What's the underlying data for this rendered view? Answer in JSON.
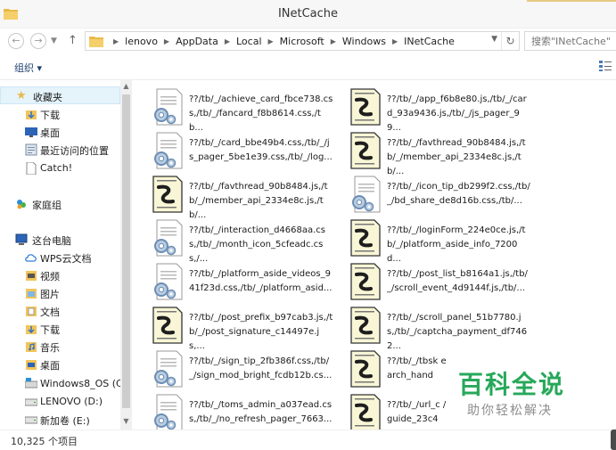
{
  "window": {
    "title": "INetCache"
  },
  "address": {
    "crumbs": [
      "lenovo",
      "AppData",
      "Local",
      "Microsoft",
      "Windows",
      "INetCache"
    ],
    "search_placeholder": "搜索\"INetCache\""
  },
  "toolbar": {
    "organize_label": "组织 ▾"
  },
  "nav": {
    "items": [
      {
        "label": "收藏夹",
        "icon": "star-icon"
      },
      {
        "label": "下载",
        "icon": "download-folder-icon"
      },
      {
        "label": "桌面",
        "icon": "desktop-icon"
      },
      {
        "label": "最近访问的位置",
        "icon": "recent-places-icon"
      },
      {
        "label": "Catch!",
        "icon": "document-icon"
      },
      {
        "label": "家庭组",
        "icon": "homegroup-icon"
      },
      {
        "label": "这台电脑",
        "icon": "computer-icon"
      },
      {
        "label": "WPS云文档",
        "icon": "cloud-icon"
      },
      {
        "label": "视频",
        "icon": "video-folder-icon"
      },
      {
        "label": "图片",
        "icon": "pictures-folder-icon"
      },
      {
        "label": "文档",
        "icon": "documents-folder-icon"
      },
      {
        "label": "下载",
        "icon": "download-folder-icon"
      },
      {
        "label": "音乐",
        "icon": "music-folder-icon"
      },
      {
        "label": "桌面",
        "icon": "desktop-icon"
      },
      {
        "label": "Windows8_OS (C:",
        "icon": "drive-icon"
      },
      {
        "label": "LENOVO (D:)",
        "icon": "drive-icon"
      },
      {
        "label": "新加卷 (E:)",
        "icon": "drive-icon"
      }
    ]
  },
  "files": [
    {
      "name": "??/tb/_/achieve_card_fbce738.css,/tb/_/fancard_f8b8614.css,/tb...",
      "type": "css"
    },
    {
      "name": "??/tb/_/app_f6b8e80.js,/tb/_/card_93a9436.js,/tb/_/js_pager_99...",
      "type": "js"
    },
    {
      "name": "??/tb/_/card_bbe49b4.css,/tb/_/js_pager_5be1e39.css,/tb/_/log...",
      "type": "css"
    },
    {
      "name": "??/tb/_/favthread_90b8484.js,/tb/_/member_api_2334e8c.js,/tb/...",
      "type": "js"
    },
    {
      "name": "??/tb/_/favthread_90b8484.js,/tb/_/member_api_2334e8c.js,/tb/...",
      "type": "js"
    },
    {
      "name": "??/tb/_/icon_tip_db299f2.css,/tb/_/bd_share_de8d16b.css,/tb/...",
      "type": "css"
    },
    {
      "name": "??/tb/_/interaction_d4668aa.css,/tb/_/month_icon_5cfeadc.css,/...",
      "type": "css"
    },
    {
      "name": "??/tb/_/loginForm_224e0ce.js,/tb/_/platform_aside_info_7200d...",
      "type": "js"
    },
    {
      "name": "??/tb/_/platform_aside_videos_941f23d.css,/tb/_/platform_asid...",
      "type": "css"
    },
    {
      "name": "??/tb/_/post_list_b8164a1.js,/tb/_/scroll_event_4d9144f.js,/tb/...",
      "type": "js"
    },
    {
      "name": "??/tb/_/post_prefix_b97cab3.js,/tb/_/post_signature_c14497e.js,...",
      "type": "js"
    },
    {
      "name": "??/tb/_/scroll_panel_51b7780.js,/tb/_/captcha_payment_df7462...",
      "type": "js"
    },
    {
      "name": "??/tb/_/sign_tip_2fb386f.css,/tb/_/sign_mod_bright_fcdb12b.cs...",
      "type": "css"
    },
    {
      "name": "??/tb/_/tbsk earch_hand",
      "type": "js"
    },
    {
      "name": "??/tb/_/toms_admin_a037ead.css,/tb/_/no_refresh_pager_7663...",
      "type": "css"
    },
    {
      "name": "??/tb/_/url_c /guide_23c4",
      "type": "js"
    }
  ],
  "status": {
    "count": "10,325 个项目"
  },
  "watermark": {
    "main": "百科全说",
    "sub": "助你轻松解决"
  },
  "colors": {
    "accent_blue": "#1c3f6e",
    "watermark_green": "#27a85a",
    "selection": "#e5f3fb"
  }
}
